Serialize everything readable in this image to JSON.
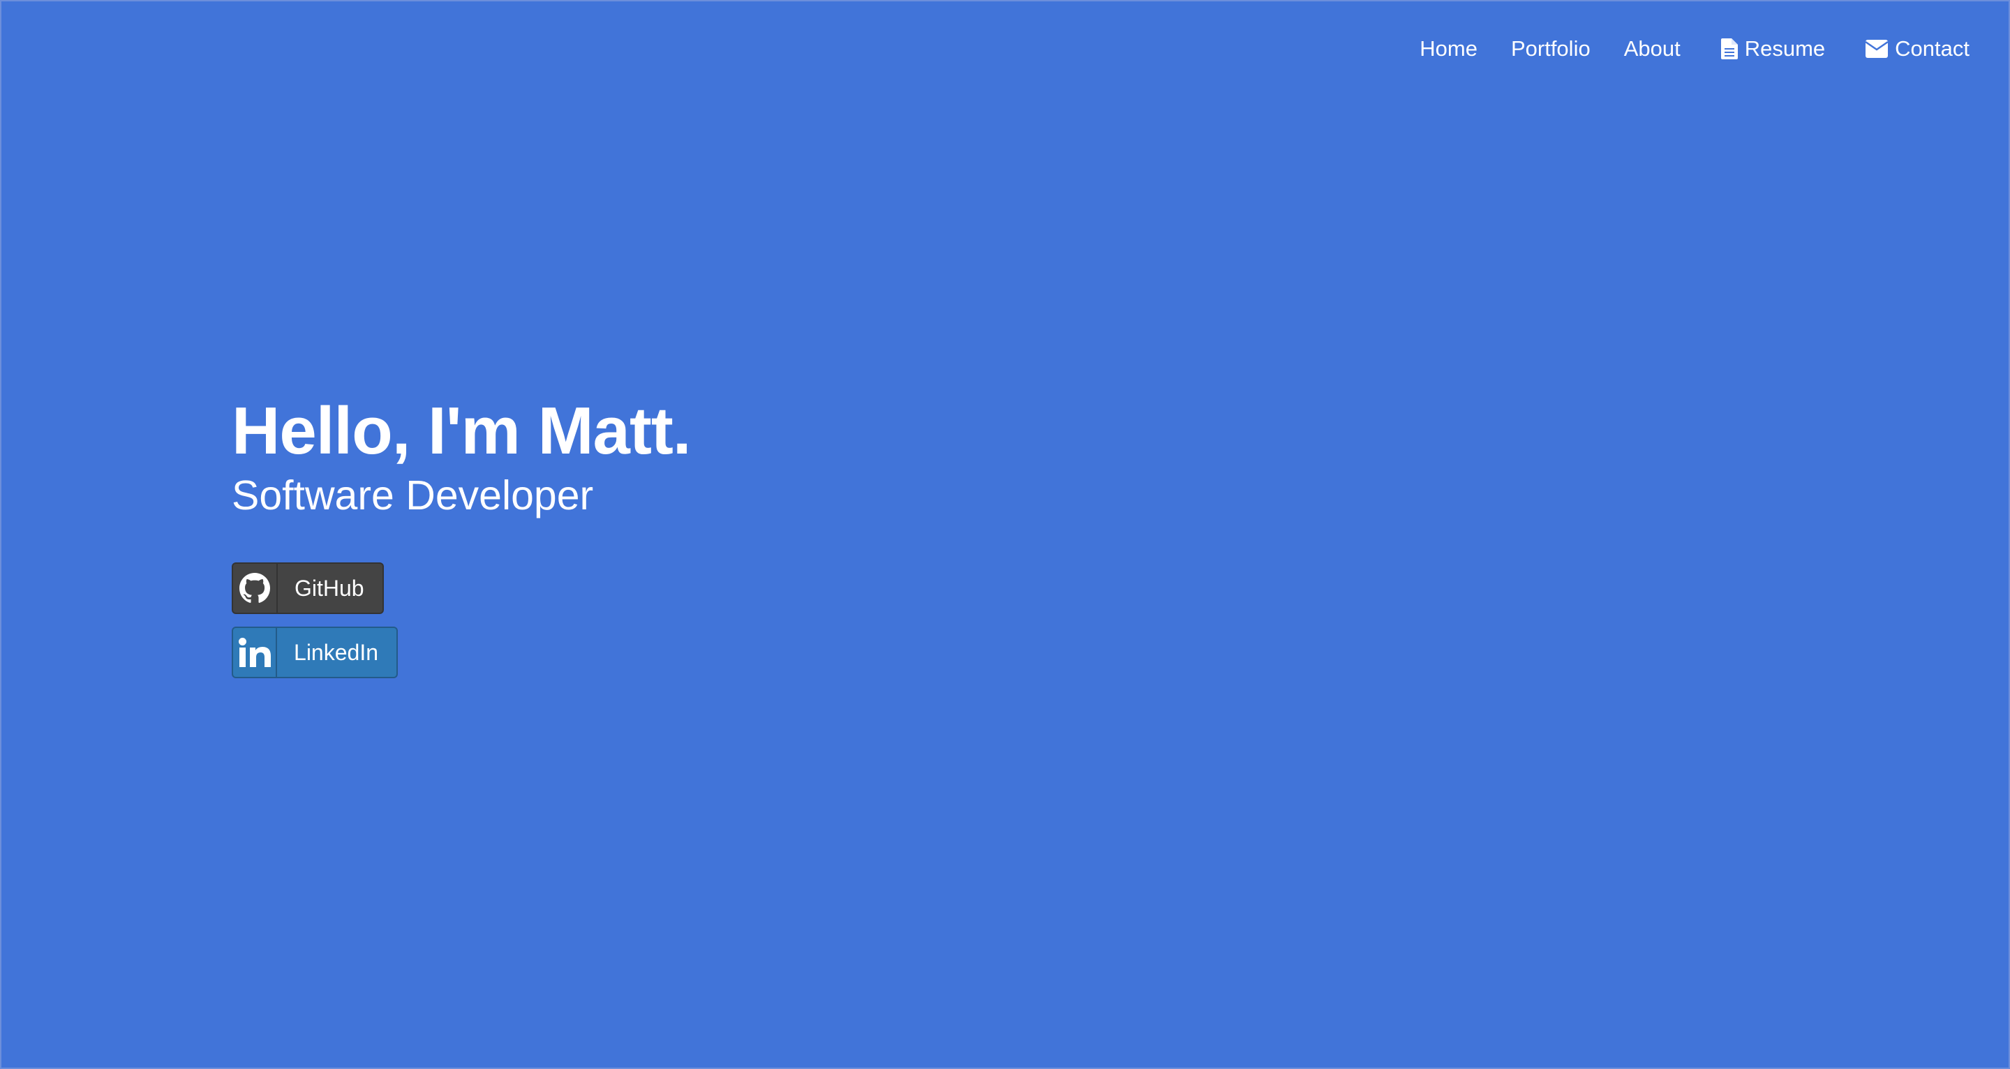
{
  "nav": {
    "items": [
      {
        "label": "Home"
      },
      {
        "label": "Portfolio"
      },
      {
        "label": "About"
      },
      {
        "label": "Resume",
        "icon": "file-icon"
      },
      {
        "label": "Contact",
        "icon": "envelope-icon"
      }
    ]
  },
  "hero": {
    "title": "Hello, I'm Matt.",
    "subtitle": "Software Developer"
  },
  "social": {
    "github_label": "GitHub",
    "github_icon": "github-icon",
    "linkedin_label": "LinkedIn",
    "linkedin_icon": "linkedin-icon"
  },
  "colors": {
    "background": "#4174d9",
    "github_button": "#444444",
    "linkedin_button": "#2f7ab8",
    "text": "#ffffff"
  }
}
